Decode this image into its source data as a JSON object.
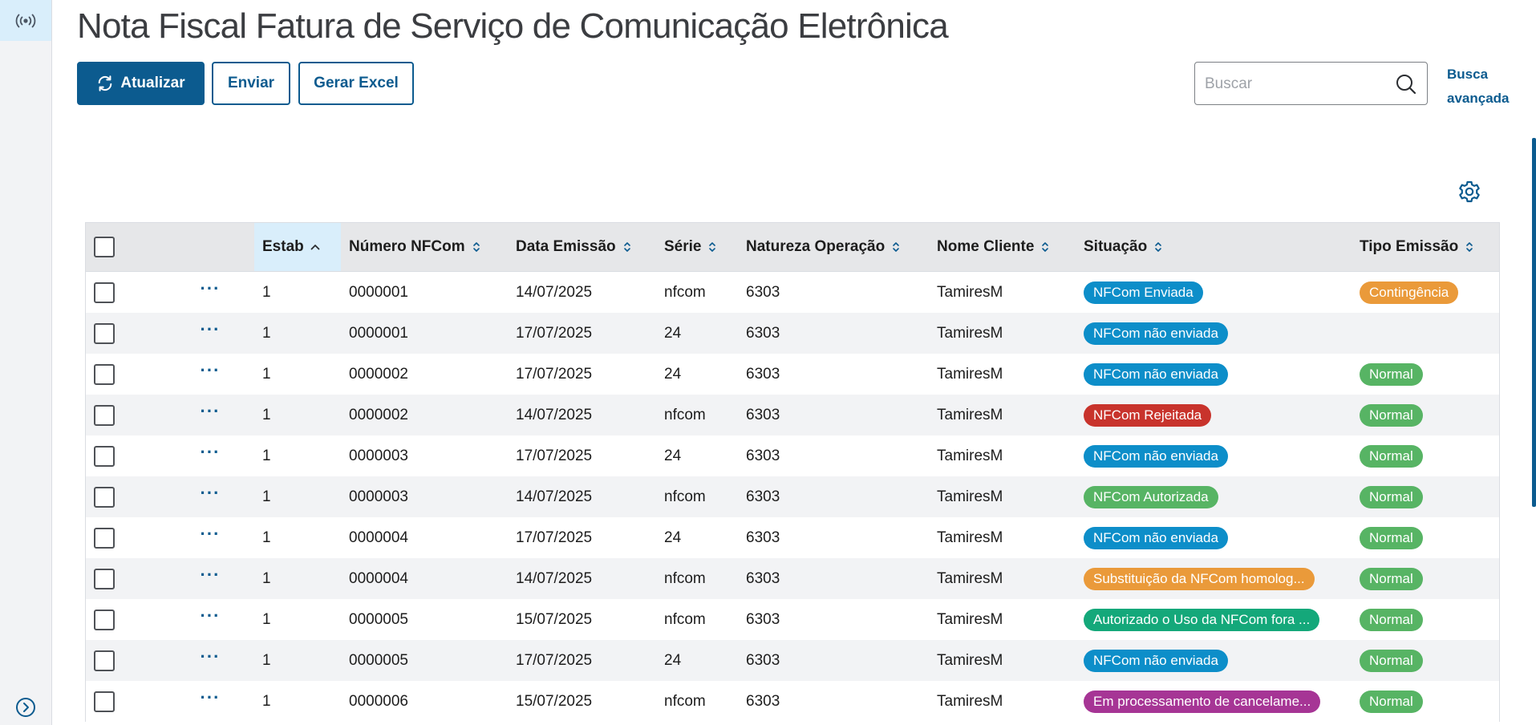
{
  "app": {
    "title": "Nota Fiscal Fatura de Serviço de Comunicação Eletrônica",
    "sidebar_top_icon": "broadcast-icon",
    "sidebar_bottom_icon": "expand-chevron-icon"
  },
  "toolbar": {
    "refresh_label": "Atualizar",
    "send_label": "Enviar",
    "excel_label": "Gerar Excel"
  },
  "search": {
    "placeholder": "Buscar",
    "value": "",
    "advanced_line1": "Busca",
    "advanced_line2": "avançada"
  },
  "colors": {
    "primary": "#0c5b8f",
    "tag_blue": "#0d8ec9",
    "tag_red": "#c8332c",
    "tag_green": "#57b464",
    "tag_orange": "#ea9a3a",
    "tag_teal": "#14a87a",
    "tag_purple": "#a63595"
  },
  "table": {
    "columns": [
      {
        "key": "estab",
        "label": "Estab",
        "sorted": "asc"
      },
      {
        "key": "numero",
        "label": "Número NFCom"
      },
      {
        "key": "data",
        "label": "Data Emissão"
      },
      {
        "key": "serie",
        "label": "Série"
      },
      {
        "key": "natureza",
        "label": "Natureza Operação"
      },
      {
        "key": "cliente",
        "label": "Nome Cliente"
      },
      {
        "key": "situacao",
        "label": "Situação"
      },
      {
        "key": "tipo",
        "label": "Tipo Emissão"
      }
    ],
    "rows": [
      {
        "estab": "1",
        "numero": "0000001",
        "data": "14/07/2025",
        "serie": "nfcom",
        "natureza": "6303",
        "cliente": "TamiresM",
        "situacao": "NFCom Enviada",
        "situacao_color": "#0d8ec9",
        "tipo": "Contingência",
        "tipo_color": "#ea9a3a"
      },
      {
        "estab": "1",
        "numero": "0000001",
        "data": "17/07/2025",
        "serie": "24",
        "natureza": "6303",
        "cliente": "TamiresM",
        "situacao": "NFCom não enviada",
        "situacao_color": "#0d8ec9",
        "tipo": "",
        "tipo_color": ""
      },
      {
        "estab": "1",
        "numero": "0000002",
        "data": "17/07/2025",
        "serie": "24",
        "natureza": "6303",
        "cliente": "TamiresM",
        "situacao": "NFCom não enviada",
        "situacao_color": "#0d8ec9",
        "tipo": "Normal",
        "tipo_color": "#57b464"
      },
      {
        "estab": "1",
        "numero": "0000002",
        "data": "14/07/2025",
        "serie": "nfcom",
        "natureza": "6303",
        "cliente": "TamiresM",
        "situacao": "NFCom Rejeitada",
        "situacao_color": "#c8332c",
        "tipo": "Normal",
        "tipo_color": "#57b464"
      },
      {
        "estab": "1",
        "numero": "0000003",
        "data": "17/07/2025",
        "serie": "24",
        "natureza": "6303",
        "cliente": "TamiresM",
        "situacao": "NFCom não enviada",
        "situacao_color": "#0d8ec9",
        "tipo": "Normal",
        "tipo_color": "#57b464"
      },
      {
        "estab": "1",
        "numero": "0000003",
        "data": "14/07/2025",
        "serie": "nfcom",
        "natureza": "6303",
        "cliente": "TamiresM",
        "situacao": "NFCom Autorizada",
        "situacao_color": "#57b464",
        "tipo": "Normal",
        "tipo_color": "#57b464"
      },
      {
        "estab": "1",
        "numero": "0000004",
        "data": "17/07/2025",
        "serie": "24",
        "natureza": "6303",
        "cliente": "TamiresM",
        "situacao": "NFCom não enviada",
        "situacao_color": "#0d8ec9",
        "tipo": "Normal",
        "tipo_color": "#57b464"
      },
      {
        "estab": "1",
        "numero": "0000004",
        "data": "14/07/2025",
        "serie": "nfcom",
        "natureza": "6303",
        "cliente": "TamiresM",
        "situacao": "Substituição da NFCom homolog...",
        "situacao_color": "#ea9a3a",
        "tipo": "Normal",
        "tipo_color": "#57b464"
      },
      {
        "estab": "1",
        "numero": "0000005",
        "data": "15/07/2025",
        "serie": "nfcom",
        "natureza": "6303",
        "cliente": "TamiresM",
        "situacao": "Autorizado o Uso da NFCom fora ...",
        "situacao_color": "#14a87a",
        "tipo": "Normal",
        "tipo_color": "#57b464"
      },
      {
        "estab": "1",
        "numero": "0000005",
        "data": "17/07/2025",
        "serie": "24",
        "natureza": "6303",
        "cliente": "TamiresM",
        "situacao": "NFCom não enviada",
        "situacao_color": "#0d8ec9",
        "tipo": "Normal",
        "tipo_color": "#57b464"
      },
      {
        "estab": "1",
        "numero": "0000006",
        "data": "15/07/2025",
        "serie": "nfcom",
        "natureza": "6303",
        "cliente": "TamiresM",
        "situacao": "Em processamento de cancelame...",
        "situacao_color": "#a63595",
        "tipo": "Normal",
        "tipo_color": "#57b464"
      }
    ]
  }
}
